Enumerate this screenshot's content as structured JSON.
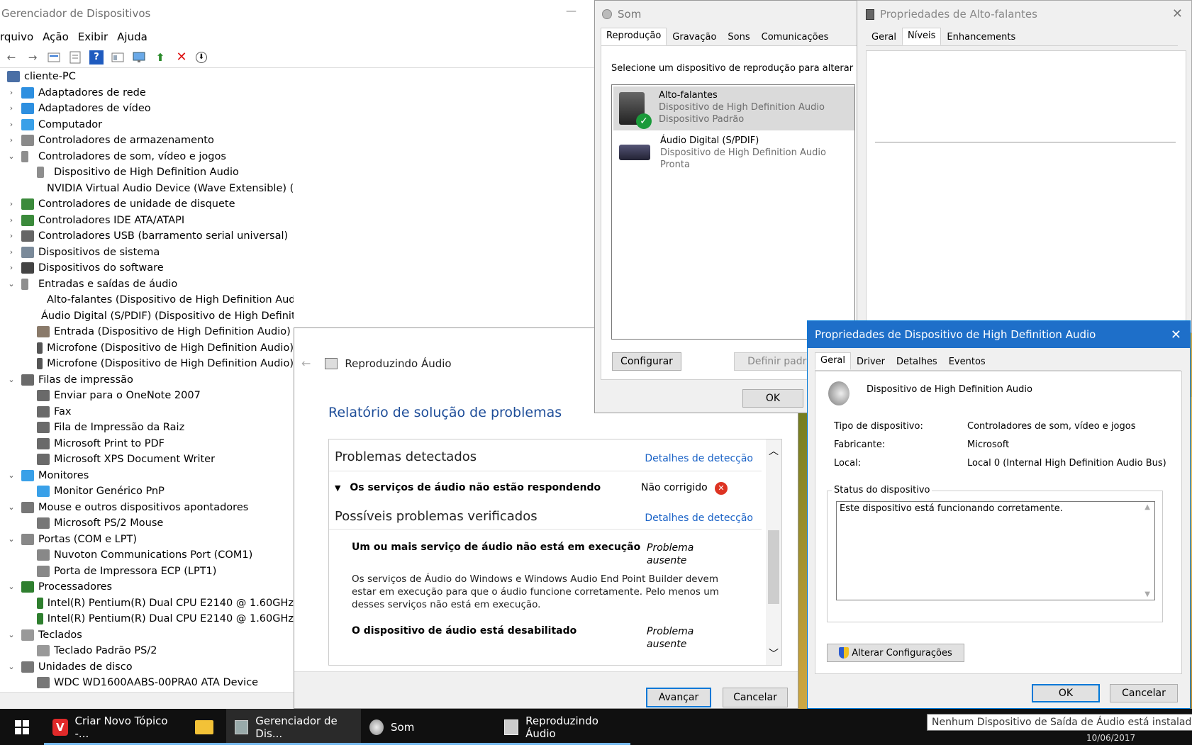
{
  "device_manager": {
    "title": "Gerenciador de Dispositivos",
    "menu": [
      "rquivo",
      "Ação",
      "Exibir",
      "Ajuda"
    ],
    "tree": [
      {
        "label": "cliente-PC",
        "level": 0,
        "exp": "",
        "icon": "computer-icon"
      },
      {
        "label": "Adaptadores de rede",
        "level": 1,
        "exp": ">",
        "icon": "network-icon"
      },
      {
        "label": "Adaptadores de vídeo",
        "level": 1,
        "exp": ">",
        "icon": "display-icon"
      },
      {
        "label": "Computador",
        "level": 1,
        "exp": ">",
        "icon": "monitor-icon"
      },
      {
        "label": "Controladores de armazenamento",
        "level": 1,
        "exp": ">",
        "icon": "storage-icon"
      },
      {
        "label": "Controladores de som, vídeo e jogos",
        "level": 1,
        "exp": "v",
        "icon": "speaker-icon"
      },
      {
        "label": "Dispositivo de High Definition Audio",
        "level": 2,
        "exp": "",
        "icon": "speaker-icon"
      },
      {
        "label": "NVIDIA Virtual Audio Device (Wave Extensible) (WDM)",
        "level": 2,
        "exp": "",
        "icon": "speaker-icon"
      },
      {
        "label": "Controladores de unidade de disquete",
        "level": 1,
        "exp": ">",
        "icon": "chip-icon"
      },
      {
        "label": "Controladores IDE ATA/ATAPI",
        "level": 1,
        "exp": ">",
        "icon": "chip-icon"
      },
      {
        "label": "Controladores USB (barramento serial universal)",
        "level": 1,
        "exp": ">",
        "icon": "usb-icon"
      },
      {
        "label": "Dispositivos de sistema",
        "level": 1,
        "exp": ">",
        "icon": "system-icon"
      },
      {
        "label": "Dispositivos do software",
        "level": 1,
        "exp": ">",
        "icon": "software-icon"
      },
      {
        "label": "Entradas e saídas de áudio",
        "level": 1,
        "exp": "v",
        "icon": "speaker-icon"
      },
      {
        "label": "Alto-falantes (Dispositivo de High Definition Audio)",
        "level": 2,
        "exp": "",
        "icon": "speaker-icon"
      },
      {
        "label": "Áudio Digital (S/PDIF) (Dispositivo de High Definition Audio)",
        "level": 2,
        "exp": "",
        "icon": "spdif-icon"
      },
      {
        "label": "Entrada (Dispositivo de High Definition Audio)",
        "level": 2,
        "exp": "",
        "icon": "line-in-icon"
      },
      {
        "label": "Microfone (Dispositivo de High Definition Audio)",
        "level": 2,
        "exp": "",
        "icon": "microphone-icon"
      },
      {
        "label": "Microfone (Dispositivo de High Definition Audio)",
        "level": 2,
        "exp": "",
        "icon": "microphone-icon"
      },
      {
        "label": "Filas de impressão",
        "level": 1,
        "exp": "v",
        "icon": "printer-icon"
      },
      {
        "label": "Enviar para o OneNote 2007",
        "level": 2,
        "exp": "",
        "icon": "printer-icon"
      },
      {
        "label": "Fax",
        "level": 2,
        "exp": "",
        "icon": "printer-icon"
      },
      {
        "label": "Fila de Impressão da Raiz",
        "level": 2,
        "exp": "",
        "icon": "printer-icon"
      },
      {
        "label": "Microsoft Print to PDF",
        "level": 2,
        "exp": "",
        "icon": "printer-icon"
      },
      {
        "label": "Microsoft XPS Document Writer",
        "level": 2,
        "exp": "",
        "icon": "printer-icon"
      },
      {
        "label": "Monitores",
        "level": 1,
        "exp": "v",
        "icon": "monitor-icon"
      },
      {
        "label": "Monitor Genérico PnP",
        "level": 2,
        "exp": "",
        "icon": "monitor-icon"
      },
      {
        "label": "Mouse e outros dispositivos apontadores",
        "level": 1,
        "exp": "v",
        "icon": "mouse-icon"
      },
      {
        "label": "Microsoft PS/2 Mouse",
        "level": 2,
        "exp": "",
        "icon": "mouse-icon"
      },
      {
        "label": "Portas (COM e LPT)",
        "level": 1,
        "exp": "v",
        "icon": "port-icon"
      },
      {
        "label": "Nuvoton Communications Port (COM1)",
        "level": 2,
        "exp": "",
        "icon": "port-icon"
      },
      {
        "label": "Porta de Impressora ECP (LPT1)",
        "level": 2,
        "exp": "",
        "icon": "port-icon"
      },
      {
        "label": "Processadores",
        "level": 1,
        "exp": "v",
        "icon": "cpu-icon"
      },
      {
        "label": "Intel(R) Pentium(R) Dual  CPU  E2140  @ 1.60GHz",
        "level": 2,
        "exp": "",
        "icon": "cpu-icon"
      },
      {
        "label": "Intel(R) Pentium(R) Dual  CPU  E2140  @ 1.60GHz",
        "level": 2,
        "exp": "",
        "icon": "cpu-icon"
      },
      {
        "label": "Teclados",
        "level": 1,
        "exp": "v",
        "icon": "keyboard-icon"
      },
      {
        "label": "Teclado Padrão PS/2",
        "level": 2,
        "exp": "",
        "icon": "keyboard-icon"
      },
      {
        "label": "Unidades de disco",
        "level": 1,
        "exp": "v",
        "icon": "disk-icon"
      },
      {
        "label": "WDC WD1600AABS-00PRA0 ATA Device",
        "level": 2,
        "exp": "",
        "icon": "disk-icon"
      }
    ]
  },
  "troubleshooter": {
    "header": "Reproduzindo Áudio",
    "title": "Relatório de solução de problemas",
    "detected_heading": "Problemas detectados",
    "details_link": "Detalhes de detecção",
    "problem": "Os serviços de áudio não estão respondendo",
    "problem_status": "Não corrigido",
    "checked_heading": "Possíveis problemas verificados",
    "item1_title": "Um ou mais serviço de áudio não está em execução",
    "item1_status_a": "Problema",
    "item1_status_b": "ausente",
    "item1_desc_1": "Os serviços de Áudio do Windows e Windows Audio End Point Builder devem",
    "item1_desc_2": "estar em execução para que o áudio funcione corretamente. Pelo menos um",
    "item1_desc_3": "desses serviços não está em execução.",
    "item2_title": "O dispositivo de áudio está desabilitado",
    "item2_status_a": "Problema",
    "item2_status_b": "ausente",
    "next_button": "Avançar",
    "cancel_button": "Cancelar"
  },
  "sound": {
    "title": "Som",
    "tabs": [
      "Reprodução",
      "Gravação",
      "Sons",
      "Comunicações"
    ],
    "instruction": "Selecione um dispositivo de reprodução para alterar suas co",
    "devices": [
      {
        "name": "Alto-falantes",
        "sub1": "Dispositivo de High Definition Audio",
        "sub2": "Dispositivo Padrão"
      },
      {
        "name": "Áudio Digital (S/PDIF)",
        "sub1": "Dispositivo de High Definition Audio",
        "sub2": "Pronta"
      }
    ],
    "configure_button": "Configurar",
    "default_button": "Definir padrã",
    "ok_button": "OK"
  },
  "speaker_props": {
    "title": "Propriedades de Alto-falantes",
    "tabs": [
      "Geral",
      "Níveis",
      "Enhancements"
    ]
  },
  "hd_props": {
    "title": "Propriedades de Dispositivo de High Definition Audio",
    "tabs": [
      "Geral",
      "Driver",
      "Detalhes",
      "Eventos"
    ],
    "device_name": "Dispositivo de High Definition Audio",
    "type_label": "Tipo de dispositivo:",
    "type_value": "Controladores de som, vídeo e jogos",
    "maker_label": "Fabricante:",
    "maker_value": "Microsoft",
    "location_label": "Local:",
    "location_value": "Local 0 (Internal High Definition Audio Bus)",
    "status_group": "Status do dispositivo",
    "status_text": "Este dispositivo está funcionando corretamente.",
    "change_button": "Alterar Configurações",
    "ok_button": "OK",
    "cancel_button": "Cancelar"
  },
  "taskbar": {
    "items": [
      "Criar Novo Tópico -...",
      "Gerenciador de Dis...",
      "Som",
      "Reproduzindo Áudio"
    ],
    "tooltip": "Nenhum Dispositivo de Saída de Áudio está instalado.",
    "date": "10/06/2017"
  }
}
